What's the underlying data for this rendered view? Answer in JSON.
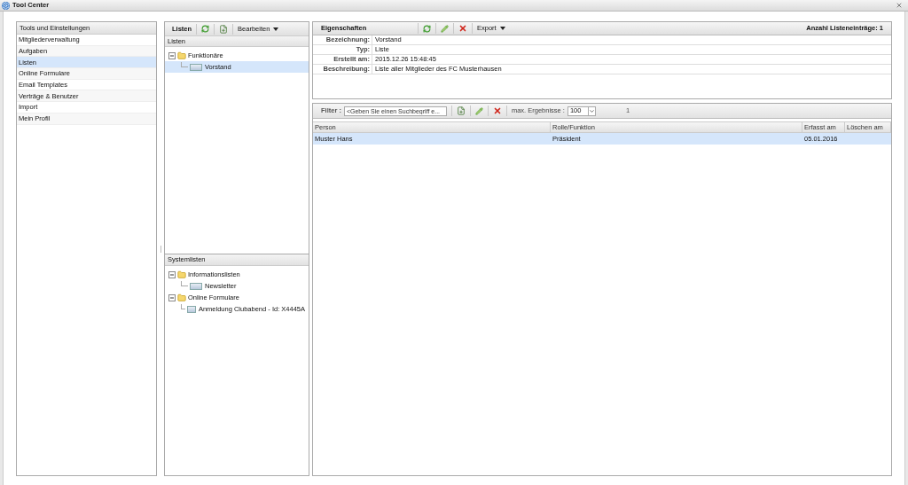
{
  "window": {
    "title": "Tool Center"
  },
  "sidebar": {
    "title": "Tools und Einstellungen",
    "items": [
      {
        "label": "Mitgliederverwaltung",
        "selected": false
      },
      {
        "label": "Aufgaben",
        "selected": false
      },
      {
        "label": "Listen",
        "selected": true
      },
      {
        "label": "Online Formulare",
        "selected": false
      },
      {
        "label": "Email Templates",
        "selected": false
      },
      {
        "label": "Verträge & Benutzer",
        "selected": false
      },
      {
        "label": "Import",
        "selected": false
      },
      {
        "label": "Mein Profil",
        "selected": false
      }
    ]
  },
  "lists_panel": {
    "title": "Listen",
    "menu": "Bearbeiten",
    "header": "Listen",
    "tree": [
      {
        "label": "Funktionäre",
        "expanded": true,
        "selected": false,
        "children": [
          {
            "label": "Vorstand",
            "selected": true
          }
        ]
      }
    ]
  },
  "system_lists": {
    "header": "Systemlisten",
    "tree": [
      {
        "label": "Informationslisten",
        "expanded": true,
        "selected": false,
        "children": [
          {
            "label": "Newsletter",
            "selected": false
          }
        ]
      },
      {
        "label": "Online Formulare",
        "expanded": true,
        "selected": false,
        "children": [
          {
            "label": "Anmeldung Clubabend - Id: X4445A",
            "selected": false
          }
        ]
      }
    ]
  },
  "properties": {
    "title": "Eigenschaften",
    "export": "Export",
    "count": "Anzahl Listeneinträge: 1",
    "fields": [
      {
        "label": "Bezeichnung:",
        "value": "Vorstand"
      },
      {
        "label": "Typ:",
        "value": "Liste"
      },
      {
        "label": "Erstellt am:",
        "value": "2015.12.26 15:48:45"
      },
      {
        "label": "Beschreibung:",
        "value": "Liste aller Mitglieder des FC Musterhausen"
      }
    ]
  },
  "filter": {
    "label": "Filter :",
    "placeholder": "<Geben Sie einen Suchbegriff e...",
    "max_label": "max. Ergebnisse :",
    "max_value": "100",
    "page": "1"
  },
  "table": {
    "columns": [
      "Person",
      "Rolle/Funktion",
      "Erfasst am",
      "Löschen am"
    ],
    "rows": [
      {
        "cells": [
          "Muster Hans",
          "Präsident",
          "05.01.2016",
          ""
        ],
        "selected": true
      }
    ]
  }
}
